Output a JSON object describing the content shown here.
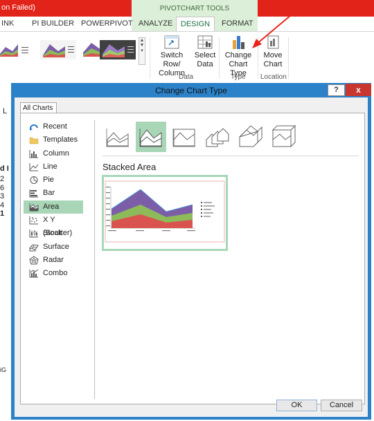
{
  "window": {
    "title_fragment": "on Failed)",
    "context_tab_group": "PIVOTCHART TOOLS"
  },
  "ribbon": {
    "tabs": [
      "INK",
      "PI BUILDER",
      "POWERPIVOT",
      "ANALYZE",
      "DESIGN",
      "FORMAT"
    ],
    "active_tab": "DESIGN",
    "buttons": {
      "switch_row_col": [
        "Switch Row/",
        "Column"
      ],
      "select_data": [
        "Select",
        "Data"
      ],
      "change_chart_type": [
        "Change",
        "Chart Type"
      ],
      "move_chart": [
        "Move",
        "Chart"
      ]
    },
    "groups": {
      "data": "Data",
      "type": "Type",
      "location": "Location"
    }
  },
  "sheet": {
    "row_fragments": [
      "L",
      "d I",
      "2",
      "6",
      "3",
      "4",
      "1",
      "iG"
    ]
  },
  "dialog": {
    "title": "Change Chart Type",
    "help_label": "?",
    "close_label": "x",
    "tab": "All Charts",
    "chart_types": [
      {
        "label": "Recent",
        "icon": "recent-icon"
      },
      {
        "label": "Templates",
        "icon": "folder-icon"
      },
      {
        "label": "Column",
        "icon": "column-chart-icon"
      },
      {
        "label": "Line",
        "icon": "line-chart-icon"
      },
      {
        "label": "Pie",
        "icon": "pie-chart-icon"
      },
      {
        "label": "Bar",
        "icon": "bar-chart-icon"
      },
      {
        "label": "Area",
        "icon": "area-chart-icon"
      },
      {
        "label": "X Y (Scatter)",
        "icon": "scatter-chart-icon"
      },
      {
        "label": "Stock",
        "icon": "stock-chart-icon"
      },
      {
        "label": "Surface",
        "icon": "surface-chart-icon"
      },
      {
        "label": "Radar",
        "icon": "radar-chart-icon"
      },
      {
        "label": "Combo",
        "icon": "combo-chart-icon"
      }
    ],
    "selected_type": "Area",
    "subtypes": [
      "area",
      "stacked-area",
      "100-stacked-area",
      "3d-area",
      "3d-stacked-area",
      "3d-100-stacked-area"
    ],
    "selected_subtype": "Stacked Area",
    "ok_label": "OK",
    "cancel_label": "Cancel"
  },
  "colors": {
    "excel_red": "#e2231a",
    "context_green": "#dcefd9",
    "selection_green": "#a8d6b7",
    "dialog_border_blue": "#2c82c9",
    "close_red": "#c7372f",
    "area_purple": "#7b5ea7",
    "area_green": "#8dbb5a",
    "area_red": "#d9534f",
    "arrow_red": "#e8251d"
  }
}
